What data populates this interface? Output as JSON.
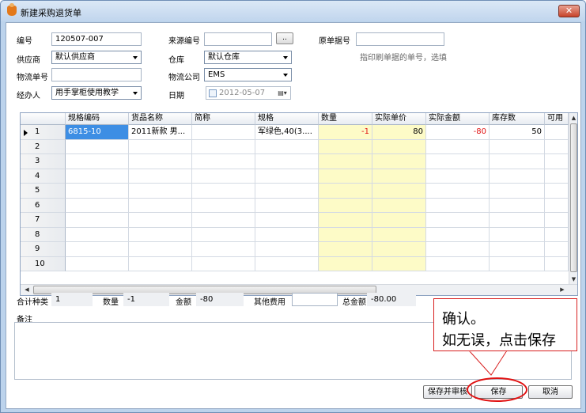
{
  "window": {
    "title": "新建采购退货单",
    "close_symbol": "✕"
  },
  "form": {
    "number_label": "编号",
    "number_value": "120507-007",
    "source_label": "来源编号",
    "source_value": "",
    "source_btn": "..",
    "orig_label": "原单据号",
    "orig_value": "",
    "orig_hint": "指印刷单据的单号，选填",
    "supplier_label": "供应商",
    "supplier_value": "默认供应商",
    "warehouse_label": "仓库",
    "warehouse_value": "默认仓库",
    "tracking_label": "物流单号",
    "tracking_value": "",
    "logistics_label": "物流公司",
    "logistics_value": "EMS",
    "handler_label": "经办人",
    "handler_value": "用手掌柜使用教学",
    "date_label": "日期",
    "date_value": "2012-05-07"
  },
  "grid": {
    "columns": [
      "规格编码",
      "货品名称",
      "简称",
      "规格",
      "数量",
      "实际单价",
      "实际金额",
      "库存数",
      "可用"
    ],
    "rows": [
      {
        "num": "1",
        "code": "6815-10",
        "name": "2011新款 男...",
        "short": "",
        "spec": "军绿色,40(3....",
        "qty": "-1",
        "price": "80",
        "amount": "-80",
        "stock": "50",
        "avail": ""
      },
      {
        "num": "2"
      },
      {
        "num": "3"
      },
      {
        "num": "4"
      },
      {
        "num": "5"
      },
      {
        "num": "6"
      },
      {
        "num": "7"
      },
      {
        "num": "8"
      },
      {
        "num": "9"
      },
      {
        "num": "10"
      }
    ]
  },
  "totals": {
    "kinds_label": "合计种类",
    "kinds_value": "1",
    "qty_label": "数量",
    "qty_value": "-1",
    "amount_label": "金额",
    "amount_value": "-80",
    "other_label": "其他费用",
    "other_value": "",
    "total_label": "总金额",
    "total_value": "-80.00"
  },
  "remark": {
    "label": "备注",
    "value": ""
  },
  "buttons": {
    "save_review": "保存并审核",
    "save": "保存",
    "cancel": "取消"
  },
  "callout": {
    "line1": "确认。",
    "line2": "如无误，点击保存"
  },
  "colors": {
    "accent": "#3d8ee4",
    "highlight": "#fdfbc7",
    "annotation": "#e01010"
  }
}
